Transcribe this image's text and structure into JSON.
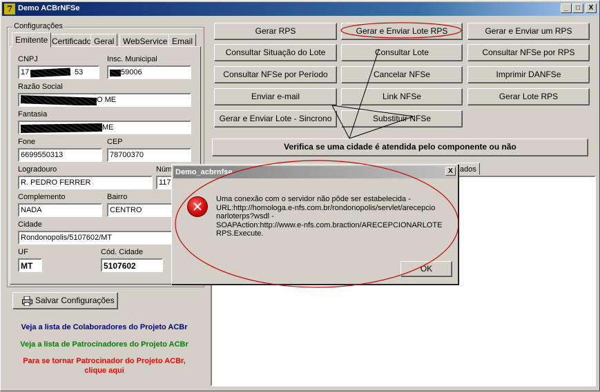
{
  "window": {
    "title": "Demo ACBrNFSe",
    "icon_glyph": "7",
    "minimize": "_",
    "maximize": "□",
    "close": "X"
  },
  "config": {
    "legend": "Configurações",
    "tabs": [
      "Emitente",
      "Certificado",
      "Geral",
      "WebService",
      "Email"
    ],
    "active_tab": "Emitente",
    "fields": {
      "cnpj": {
        "label": "CNPJ",
        "value": "17",
        "value_tail": "53"
      },
      "insc_municipal": {
        "label": "Insc. Municipal",
        "value": "",
        "value_tail": "59006"
      },
      "razao_social": {
        "label": "Razão Social",
        "value": "",
        "value_tail": "O ME"
      },
      "fantasia": {
        "label": "Fantasia",
        "value": "",
        "value_tail": "ME"
      },
      "fone": {
        "label": "Fone",
        "value": "6699550313"
      },
      "cep": {
        "label": "CEP",
        "value": "78700370"
      },
      "logradouro": {
        "label": "Logradouro",
        "value": "R. PEDRO FERRER"
      },
      "numero": {
        "label": "Núm",
        "value": "117"
      },
      "complemento": {
        "label": "Complemento",
        "value": "NADA"
      },
      "bairro": {
        "label": "Bairro",
        "value": "CENTRO"
      },
      "cidade": {
        "label": "Cidade",
        "value": "Rondonopolis/5107602/MT"
      },
      "uf": {
        "label": "UF",
        "value": "MT"
      },
      "cod_cidade": {
        "label": "Cód. Cidade",
        "value": "5107602"
      }
    }
  },
  "save_button": "Salvar Configurações",
  "links": {
    "colaboradores": "Veja a lista de Colaboradores do Projeto ACBr",
    "patrocinadores": "Veja a lista de Patrocinadores do Projeto ACBr",
    "tornar_line1": "Para se tornar Patrocinador do Projeto ACBr,",
    "tornar_line2": "clique aqui",
    "colors": {
      "colaboradores": "#000080",
      "patrocinadores": "#008000",
      "tornar": "#ff0000"
    }
  },
  "actions": {
    "gerar_rps": "Gerar RPS",
    "gerar_enviar_lote": "Gerar e Enviar Lote RPS",
    "gerar_enviar_um": "Gerar e Enviar um RPS",
    "consultar_situacao": "Consultar Situação do Lote",
    "consultar_lote": "Consultar Lote",
    "consultar_nfse_rps": "Consultar NFSe por RPS",
    "consultar_periodo": "Consultar NFSe por Período",
    "cancelar_nfse": "Cancelar NFSe",
    "imprimir_danfse": "Imprimir DANFSe",
    "enviar_email": "Enviar e-mail",
    "link_nfse": "Link NFSe",
    "gerar_lote_rps": "Gerar Lote RPS",
    "gerar_enviar_sincrono": "Gerar e Enviar Lote - Sincrono",
    "substituir_nfse": "Substituir NFSe",
    "verifica_cidade": "Verifica se uma cidade é atendida pelo componente ou não"
  },
  "result_tab_fragment": "ados",
  "dialog": {
    "title": "Demo_acbrnfse",
    "close": "X",
    "icon": "error-icon",
    "message_lines": [
      "Uma conexão com o servidor não pôde ser estabelecida -",
      "URL:http://homologa.e-nfs.com.br/rondonopolis/servlet/arecepcio",
      "narloterps?wsdl -",
      "SOAPAction:http://www.e-nfs.com.braction/ARECEPCIONARLOTE",
      "RPS.Execute."
    ],
    "ok": "OK"
  },
  "annotation_color": "#cc0000"
}
